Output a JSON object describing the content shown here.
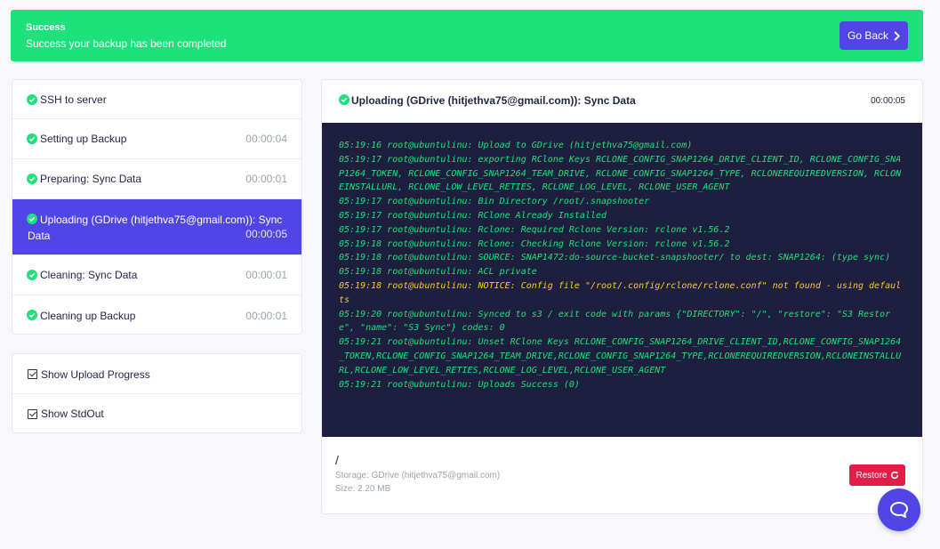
{
  "banner": {
    "title": "Success",
    "message": "Success your backup has been completed",
    "go_back_label": "Go Back",
    "color": "#1de27b"
  },
  "steps": [
    {
      "label": "SSH to server",
      "time": "",
      "status": "done"
    },
    {
      "label": "Setting up Backup",
      "time": "00:00:04",
      "status": "done"
    },
    {
      "label": "Preparing: Sync Data",
      "time": "00:00:01",
      "status": "done"
    },
    {
      "label": "Uploading (GDrive (hitjethva75@gmail.com)): Sync Data",
      "time": "00:00:05",
      "status": "active"
    },
    {
      "label": "Cleaning: Sync Data",
      "time": "00:00:01",
      "status": "done"
    },
    {
      "label": "Cleaning up Backup",
      "time": "00:00:01",
      "status": "done"
    }
  ],
  "options": {
    "show_upload_progress": "Show Upload Progress",
    "show_stdout": "Show StdOut"
  },
  "main": {
    "title": "Uploading (GDrive (hitjethva75@gmail.com)): Sync Data",
    "time": "00:00:05"
  },
  "console_lines": [
    {
      "text": "05:19:16 root@ubuntulinu: Upload to GDrive (hitjethva75@gmail.com)",
      "level": "info"
    },
    {
      "text": "05:19:17 root@ubuntulinu: exporting RClone Keys RCLONE_CONFIG_SNAP1264_DRIVE_CLIENT_ID, RCLONE_CONFIG_SNAP1264_TOKEN, RCLONE_CONFIG_SNAP1264_TEAM_DRIVE, RCLONE_CONFIG_SNAP1264_TYPE, RCLONEREQUIREDVERSION, RCLONEINSTALLURL, RCLONE_LOW_LEVEL_RETIES, RCLONE_LOG_LEVEL, RCLONE_USER_AGENT",
      "level": "info"
    },
    {
      "text": "05:19:17 root@ubuntulinu: Bin Directory /root/.snapshooter",
      "level": "info"
    },
    {
      "text": "05:19:17 root@ubuntulinu: RClone Already Installed",
      "level": "info"
    },
    {
      "text": "05:19:17 root@ubuntulinu: Rclone: Required Rclone Version: rclone v1.56.2",
      "level": "info"
    },
    {
      "text": "05:19:18 root@ubuntulinu: Rclone: Checking Rclone Version: rclone v1.56.2",
      "level": "info"
    },
    {
      "text": "05:19:18 root@ubuntulinu: SOURCE: SNAP1472:do-source-bucket-snapshooter/ to dest: SNAP1264: (type sync)",
      "level": "info"
    },
    {
      "text": "05:19:18 root@ubuntulinu: ACL private",
      "level": "info"
    },
    {
      "text": "05:19:18 root@ubuntulinu: NOTICE: Config file \"/root/.config/rclone/rclone.conf\" not found - using defaults",
      "level": "warn"
    },
    {
      "text": "05:19:20 root@ubuntulinu: Synced to s3 / exit code with params {\"DIRECTORY\": \"/\", \"restore\": \"S3 Restore\", \"name\": \"S3 Sync\"} codes: 0",
      "level": "info"
    },
    {
      "text": "05:19:21 root@ubuntulinu: Unset RClone Keys RCLONE_CONFIG_SNAP1264_DRIVE_CLIENT_ID,RCLONE_CONFIG_SNAP1264_TOKEN,RCLONE_CONFIG_SNAP1264_TEAM_DRIVE,RCLONE_CONFIG_SNAP1264_TYPE,RCLONEREQUIREDVERSION,RCLONEINSTALLURL,RCLONE_LOW_LEVEL_RETIES,RCLONE_LOG_LEVEL,RCLONE_USER_AGENT",
      "level": "info"
    },
    {
      "text": "05:19:21 root@ubuntulinu: Uploads Success (0)",
      "level": "info"
    }
  ],
  "result": {
    "path": "/",
    "storage": "Storage: GDrive (hitjethva75@gmail.com)",
    "size": "Size: 2.20 MB",
    "restore_label": "Restore"
  },
  "colors": {
    "accent": "#4f46e5",
    "success": "#1de27b",
    "danger": "#e11d48",
    "console_bg": "#1e1f3f",
    "warning": "#facc15"
  },
  "icons": {
    "step_status": "check-circle-icon",
    "go_back": "chevron-right-icon",
    "restore": "refresh-icon",
    "chat": "chat-bubble-icon"
  }
}
